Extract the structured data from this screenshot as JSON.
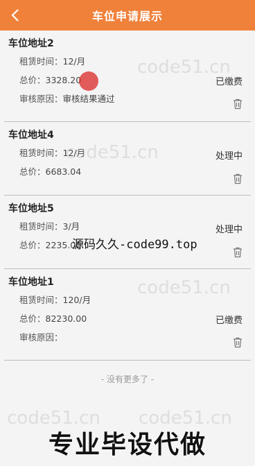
{
  "header": {
    "title": "车位申请展示",
    "back_icon": "chevron-left-icon"
  },
  "labels": {
    "rent_time": "租赁时间：",
    "total": "总价：",
    "review": "审核原因："
  },
  "items": [
    {
      "name": "车位地址2",
      "rent_time": "12/月",
      "total": "3328.20",
      "review": "审核结果通过",
      "status": "已缴费"
    },
    {
      "name": "车位地址4",
      "rent_time": "12/月",
      "total": "6683.04",
      "review": "",
      "status": "处理中"
    },
    {
      "name": "车位地址5",
      "rent_time": "3/月",
      "total": "2235.00",
      "review": "",
      "status": "处理中"
    },
    {
      "name": "车位地址1",
      "rent_time": "120/月",
      "total": "82230.00",
      "review": "",
      "status": "已缴费"
    }
  ],
  "footer": {
    "no_more": "- 没有更多了 -"
  },
  "watermarks": {
    "site": "code51.cn",
    "center": "源码久久-code99.top",
    "bottom": "专业毕设代做"
  },
  "colors": {
    "header_bg": "#f0813a",
    "tap_dot": "#dc2828"
  }
}
